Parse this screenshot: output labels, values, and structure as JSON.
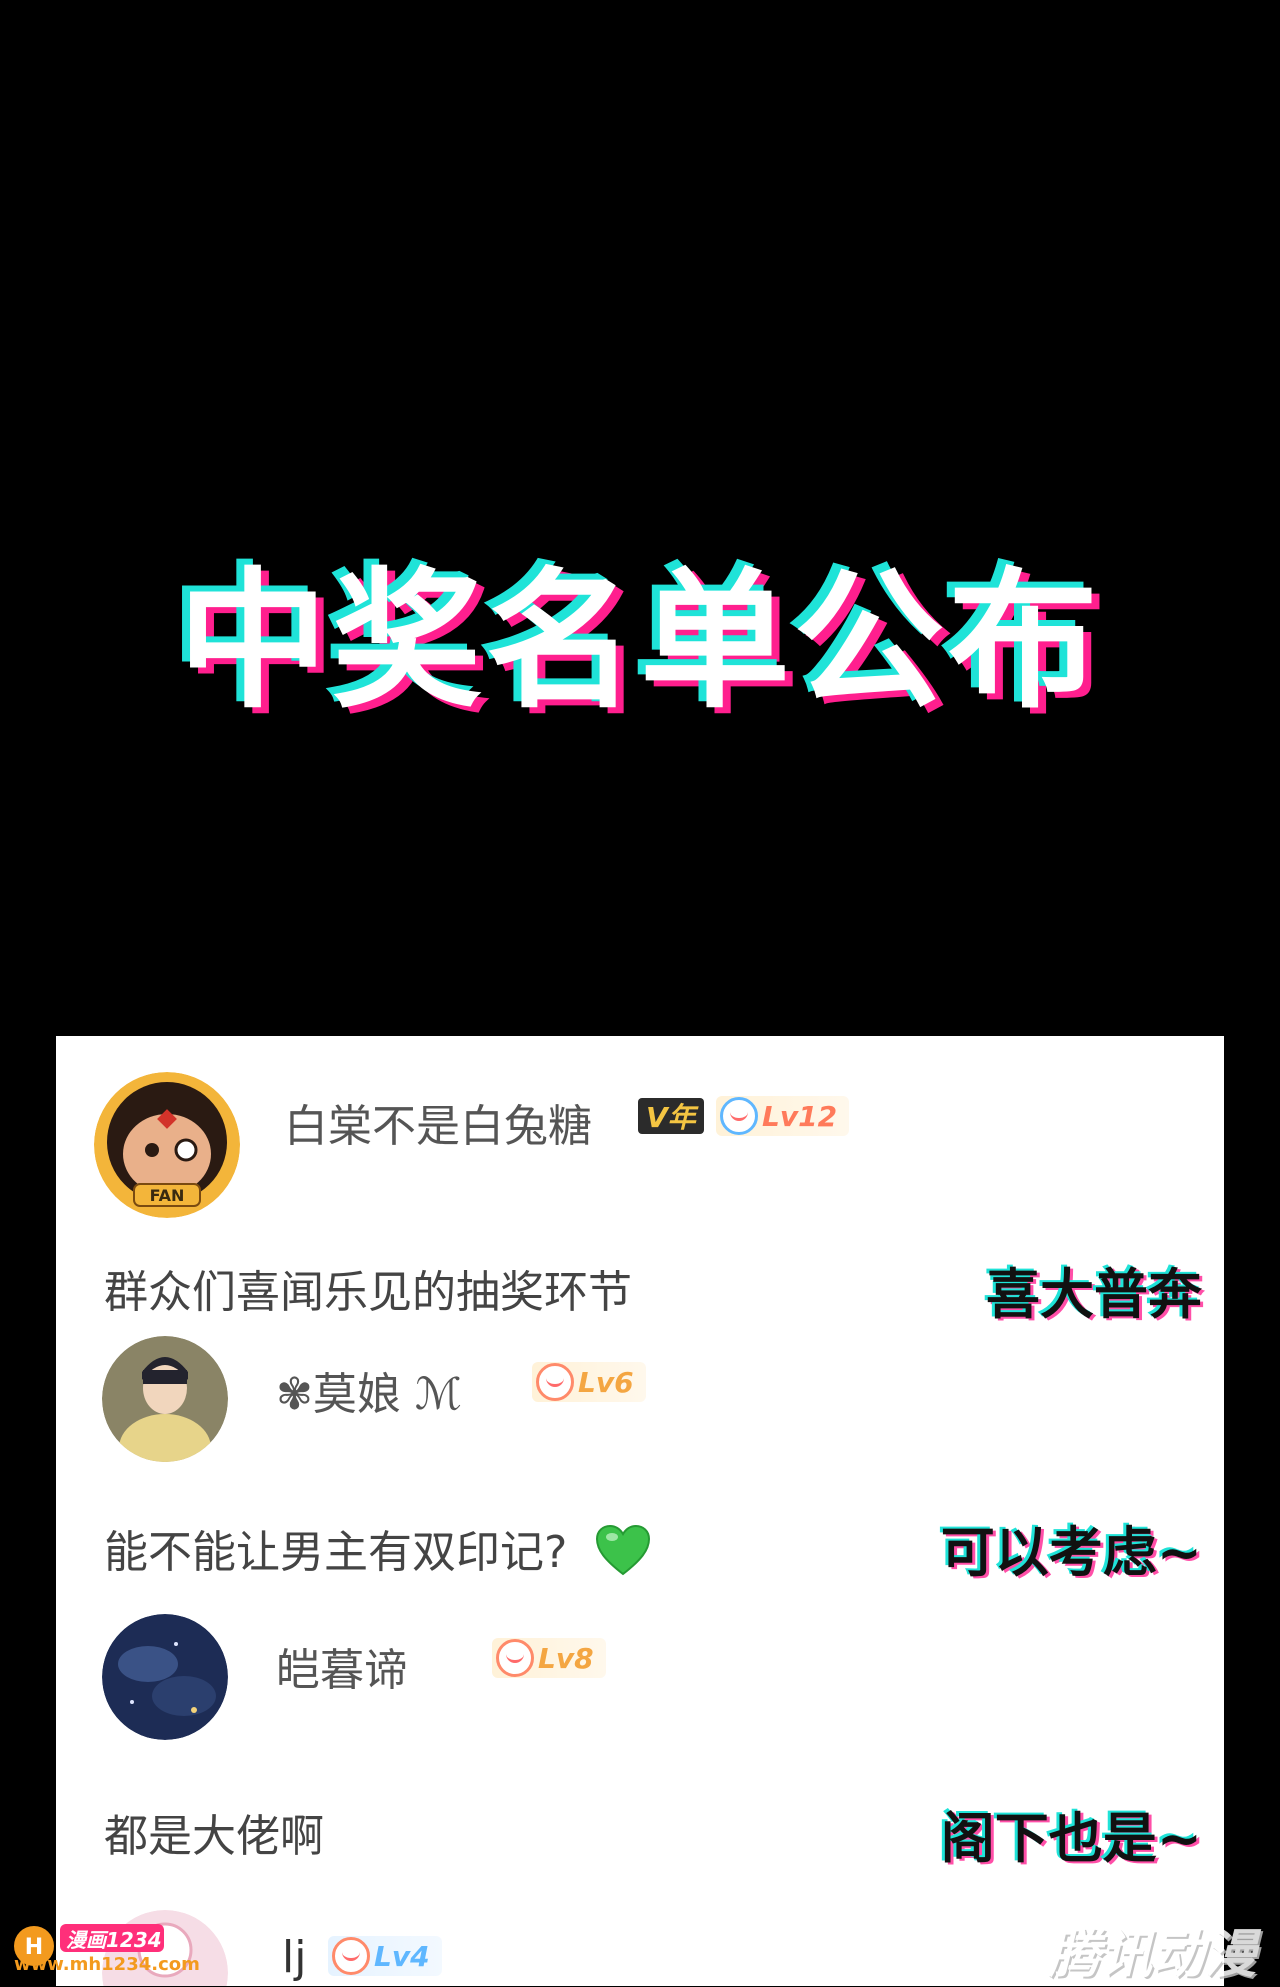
{
  "banner": {
    "title": "中奖名单公布"
  },
  "comments": [
    {
      "username": "白棠不是白兔糖",
      "vip_label": "V年",
      "level": "Lv12",
      "text": "群众们喜闻乐见的抽奖环节",
      "reply": "喜大普奔"
    },
    {
      "username": "✾莫娘 ℳ",
      "level": "Lv6",
      "text": "能不能让男主有双印记?",
      "text_emoji": "green-heart",
      "reply": "可以考虑~"
    },
    {
      "username": "皑暮谛",
      "level": "Lv8",
      "text": "都是大佬啊",
      "reply": "阁下也是~"
    },
    {
      "username": "lj",
      "level": "Lv4"
    }
  ],
  "watermarks": {
    "left_top": "漫画1234",
    "left_bottom": "www.mh1234.com",
    "right": "腾讯动漫"
  },
  "colors": {
    "cyan": "#1fe3d8",
    "magenta": "#ff1f8e",
    "level_text": "#5fb7ff",
    "level_text_high": "#ff7a5a"
  }
}
